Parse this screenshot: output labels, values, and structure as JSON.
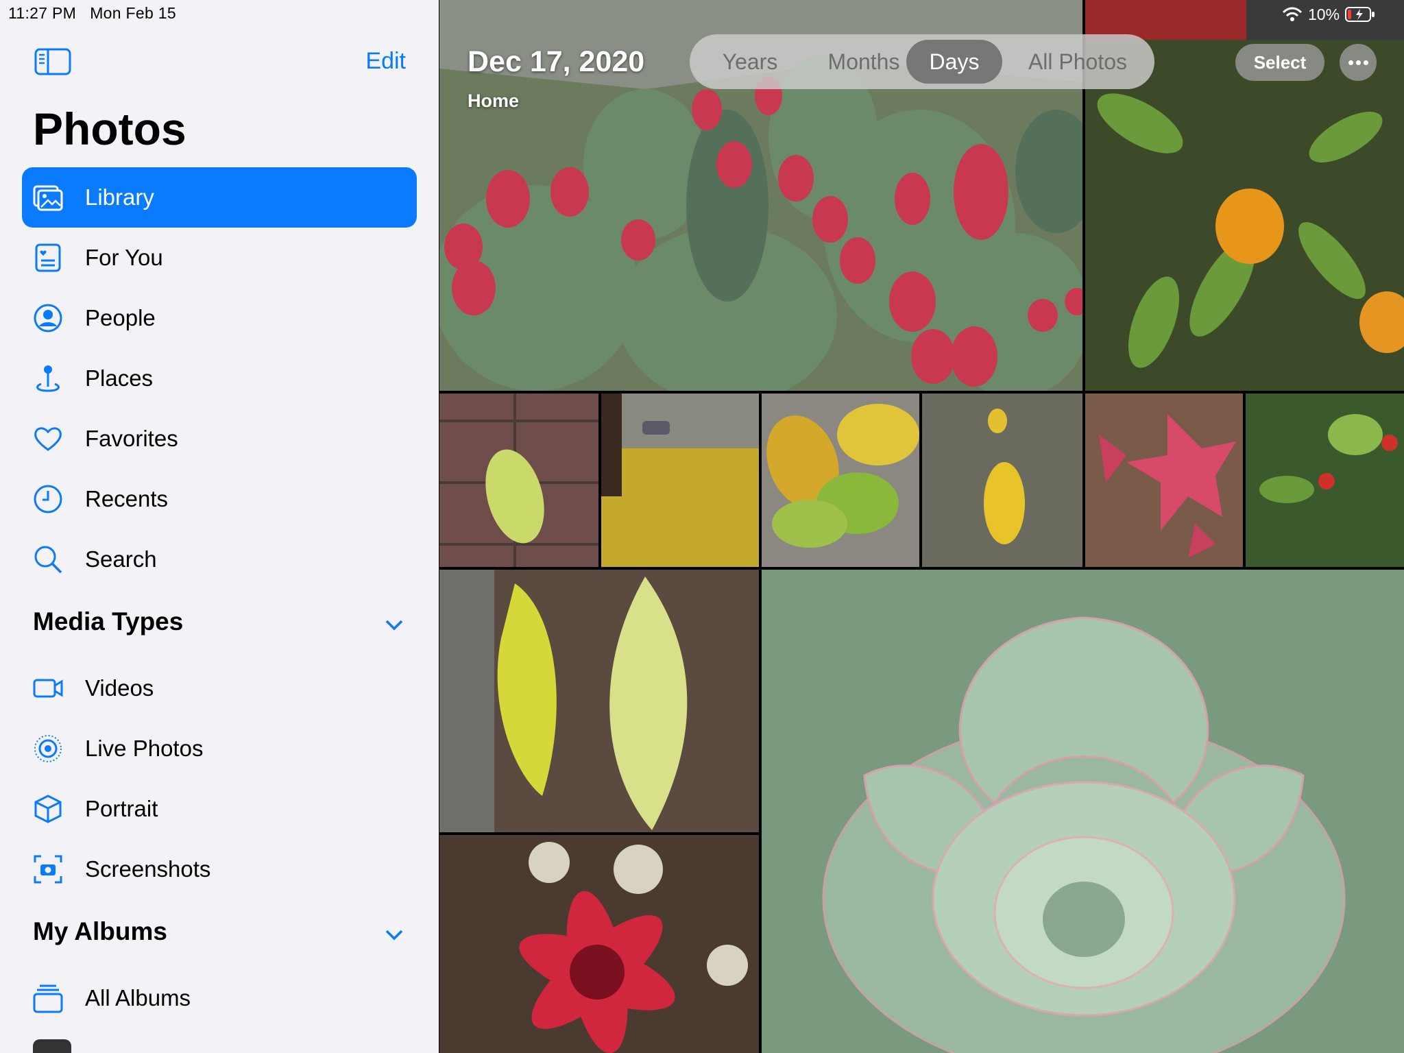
{
  "status_bar": {
    "time": "11:27 PM",
    "date": "Mon Feb 15",
    "battery": "10%"
  },
  "sidebar": {
    "edit_label": "Edit",
    "title": "Photos",
    "items": [
      {
        "label": "Library",
        "icon": "photo-library-icon"
      },
      {
        "label": "For You",
        "icon": "for-you-icon"
      },
      {
        "label": "People",
        "icon": "person-circle-icon"
      },
      {
        "label": "Places",
        "icon": "map-pin-icon"
      },
      {
        "label": "Favorites",
        "icon": "heart-icon"
      },
      {
        "label": "Recents",
        "icon": "clock-icon"
      },
      {
        "label": "Search",
        "icon": "search-icon"
      }
    ],
    "media_types": {
      "heading": "Media Types",
      "items": [
        {
          "label": "Videos",
          "icon": "video-icon"
        },
        {
          "label": "Live Photos",
          "icon": "live-photo-icon"
        },
        {
          "label": "Portrait",
          "icon": "cube-icon"
        },
        {
          "label": "Screenshots",
          "icon": "screenshot-icon"
        }
      ]
    },
    "my_albums": {
      "heading": "My Albums",
      "items": [
        {
          "label": "All Albums",
          "icon": "albums-stack-icon"
        }
      ]
    }
  },
  "header": {
    "date": "Dec 17, 2020",
    "location": "Home",
    "segments": [
      "Years",
      "Months",
      "Days",
      "All Photos"
    ],
    "active_segment": "Days",
    "select_label": "Select"
  },
  "colors": {
    "accent": "#0a7aff",
    "sidebar_bg": "#f2f2f7"
  }
}
